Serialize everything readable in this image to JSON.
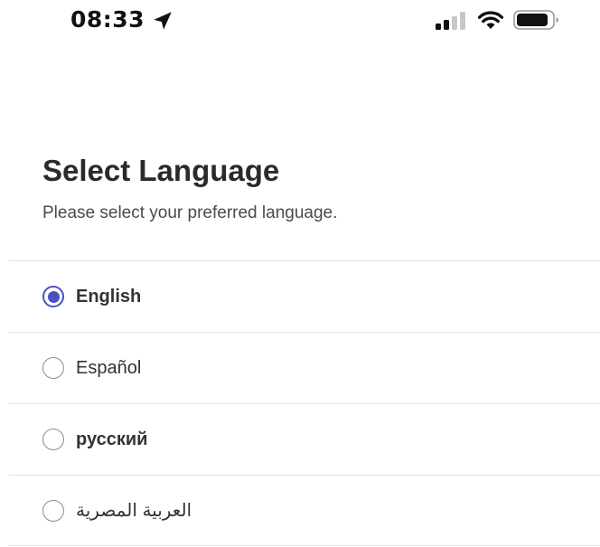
{
  "status_bar": {
    "time": "08:33"
  },
  "header": {
    "title": "Select Language",
    "subtitle": "Please select your preferred language."
  },
  "languages": [
    {
      "label": "English",
      "selected": true
    },
    {
      "label": "Español",
      "selected": false
    },
    {
      "label": "русский",
      "selected": false
    },
    {
      "label": "العربية المصرية",
      "selected": false
    }
  ],
  "colors": {
    "accent": "#4a4fc4",
    "divider": "#e4e4e4",
    "title": "#2a2a2a"
  }
}
